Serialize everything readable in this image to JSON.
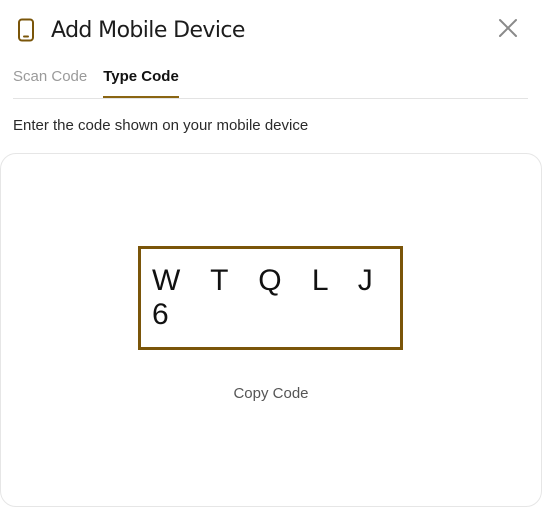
{
  "dialog": {
    "title": "Add Mobile Device",
    "title_icon": "mobile-phone-icon",
    "close_icon": "close-icon"
  },
  "tabs": [
    {
      "label": "Scan Code",
      "active": false
    },
    {
      "label": "Type Code",
      "active": true
    }
  ],
  "instruction": "Enter the code shown on your mobile device",
  "code": {
    "value": "WTQLJ6",
    "display": "W T Q L J 6",
    "copy_label": "Copy Code"
  },
  "colors": {
    "accent": "#7a5509",
    "tab_underline": "#8a6512",
    "inactive_text": "#9a9a9a",
    "border": "#e6e6e6"
  }
}
